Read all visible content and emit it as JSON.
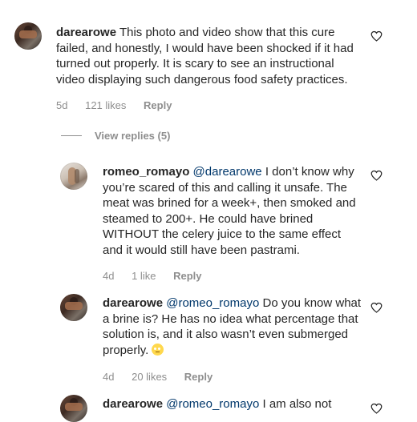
{
  "comments": [
    {
      "username": "darearowe",
      "mention": "",
      "text": "This photo and video show that this cure failed, and honestly, I would have been shocked if it had turned out properly. It is scary to see an instructional video displaying such dangerous food safety practices.",
      "time": "5d",
      "likes": "121 likes",
      "reply": "Reply"
    },
    {
      "username": "romeo_romayo",
      "mention": "@darearowe",
      "text": "I don’t know why you’re scared of this and calling it unsafe. The meat was brined for a week+, then smoked and steamed to 200+. He could have brined WITHOUT the celery juice to the same effect and it would still have been pastrami.",
      "time": "4d",
      "likes": "1 like",
      "reply": "Reply"
    },
    {
      "username": "darearowe",
      "mention": "@romeo_romayo",
      "text": "Do you know what a brine is? He has no idea what percentage that solution is, and it also wasn’t even submerged properly.",
      "emoji": "rolling-eyes-emoji",
      "time": "4d",
      "likes": "20 likes",
      "reply": "Reply"
    },
    {
      "username": "darearowe",
      "mention": "@romeo_romayo",
      "text": "I am also not"
    }
  ],
  "view_replies": "View replies (5)",
  "icons": {
    "heart": "heart-outline-icon",
    "avatar": "user-avatar"
  },
  "colors": {
    "text": "#262626",
    "mention": "#00376b",
    "muted": "#8e8e8e"
  }
}
